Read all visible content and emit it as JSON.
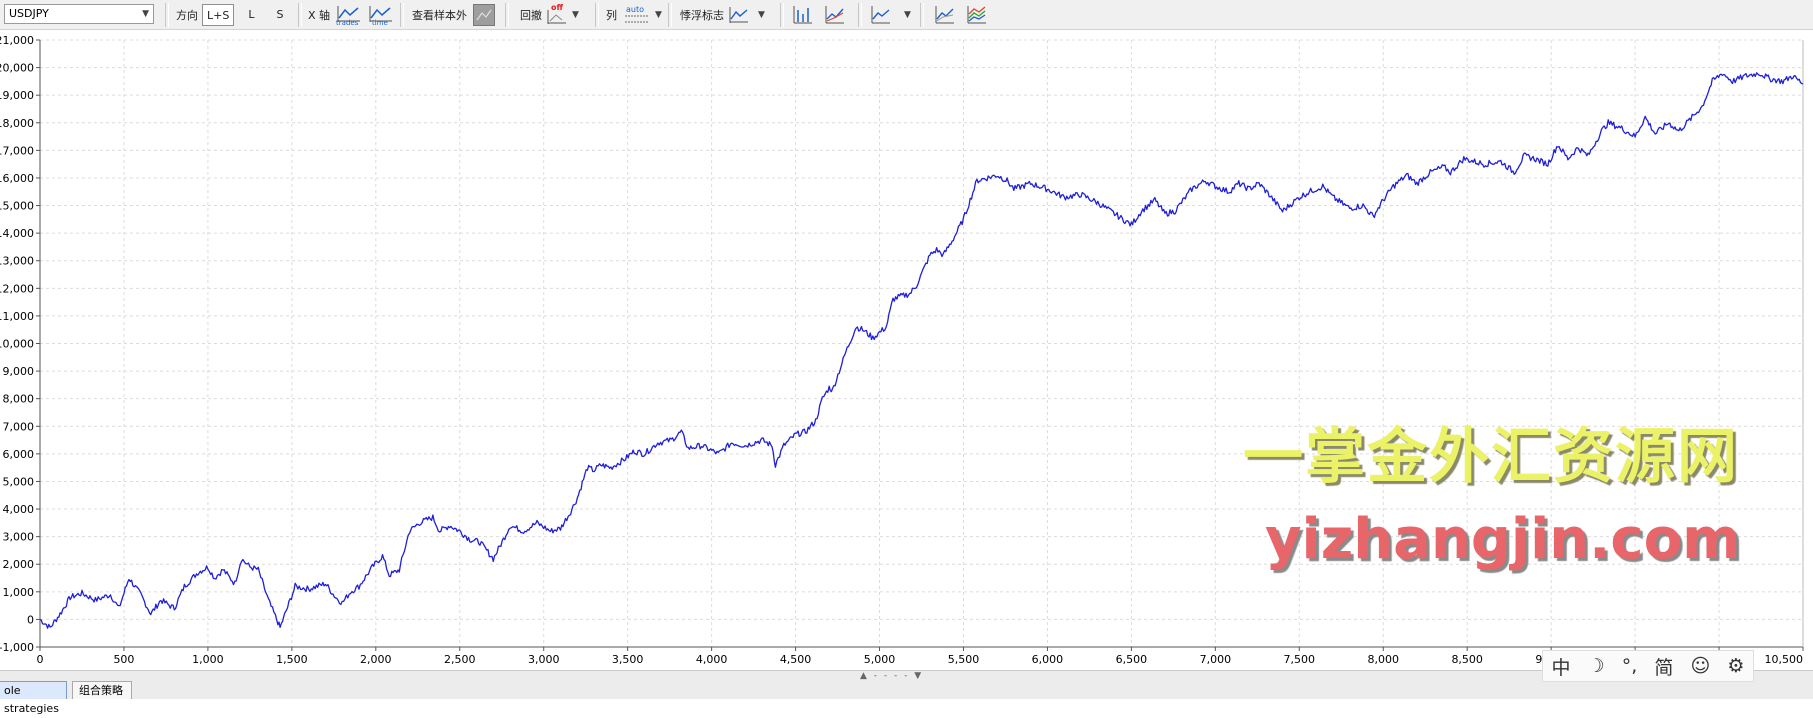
{
  "toolbar": {
    "symbol": "USDJPY",
    "direction_label": "方向",
    "direction_options": [
      "L+S",
      "L",
      "S"
    ],
    "xaxis_label": "X 轴",
    "xaxis_trades": "trades",
    "xaxis_time": "time",
    "out_of_sample_label": "查看样本外",
    "drawdown_label": "回撤",
    "drawdown_state": "off",
    "column_label": "列",
    "column_state": "auto",
    "floating_label": "悸浮标志"
  },
  "chart_data": {
    "type": "line",
    "title": "",
    "xlabel": "",
    "ylabel": "",
    "xlim": [
      0,
      10500
    ],
    "ylim": [
      -1000,
      21000
    ],
    "x_ticks": [
      "0",
      "500",
      "1,000",
      "1,500",
      "2,000",
      "2,500",
      "3,000",
      "3,500",
      "4,000",
      "4,500",
      "5,000",
      "5,500",
      "6,000",
      "6,500",
      "7,000",
      "7,500",
      "8,000",
      "8,500",
      "9,000",
      "9,500",
      "10,000",
      "10,500"
    ],
    "y_ticks": [
      "-1,000",
      "0",
      "1,000",
      "2,000",
      "3,000",
      "4,000",
      "5,000",
      "6,000",
      "7,000",
      "8,000",
      "9,000",
      "10,000",
      "11,000",
      "12,000",
      "13,000",
      "14,000",
      "15,000",
      "16,000",
      "17,000",
      "18,000",
      "19,000",
      "20,000",
      "21,000"
    ],
    "grid": true,
    "series": [
      {
        "color": "#1f1fd6",
        "x": [
          0,
          60,
          120,
          180,
          250,
          330,
          420,
          470,
          530,
          600,
          660,
          720,
          800,
          860,
          940,
          1000,
          1040,
          1090,
          1160,
          1200,
          1250,
          1300,
          1360,
          1410,
          1430,
          1460,
          1520,
          1600,
          1700,
          1760,
          1800,
          1850,
          1900,
          1980,
          2040,
          2080,
          2140,
          2200,
          2260,
          2340,
          2380,
          2440,
          2500,
          2560,
          2620,
          2700,
          2760,
          2800,
          2880,
          2960,
          3040,
          3100,
          3160,
          3200,
          3260,
          3300,
          3340,
          3400,
          3480,
          3540,
          3600,
          3680,
          3760,
          3820,
          3860,
          3940,
          4040,
          4120,
          4200,
          4300,
          4360,
          4380,
          4430,
          4500,
          4560,
          4620,
          4660,
          4700,
          4720,
          4760,
          4800,
          4860,
          4900,
          4960,
          5040,
          5080,
          5120,
          5180,
          5220,
          5300,
          5340,
          5380,
          5440,
          5500,
          5540,
          5580,
          5640,
          5700,
          5760,
          5800,
          5900,
          6000,
          6100,
          6200,
          6300,
          6400,
          6500,
          6560,
          6640,
          6700,
          6760,
          6860,
          6940,
          7000,
          7080,
          7140,
          7200,
          7260,
          7320,
          7400,
          7500,
          7560,
          7640,
          7700,
          7800,
          7880,
          7940,
          8000,
          8060,
          8140,
          8200,
          8280,
          8360,
          8400,
          8480,
          8600,
          8700,
          8780,
          8840,
          8900,
          8980,
          9040,
          9100,
          9160,
          9220,
          9300,
          9340,
          9420,
          9500,
          9560,
          9620,
          9700,
          9760,
          9840,
          9900,
          9960,
          10020,
          10080,
          10160,
          10240,
          10300,
          10380,
          10440,
          10500
        ],
        "y": [
          0,
          -300,
          200,
          800,
          950,
          700,
          900,
          400,
          1500,
          900,
          200,
          700,
          400,
          1200,
          1700,
          1900,
          1500,
          1800,
          1300,
          2200,
          1900,
          1800,
          700,
          0,
          -300,
          200,
          1200,
          1100,
          1300,
          800,
          600,
          1000,
          1200,
          1900,
          2300,
          1600,
          1800,
          3200,
          3500,
          3700,
          3200,
          3400,
          3200,
          2900,
          2800,
          2200,
          2900,
          3400,
          3200,
          3500,
          3200,
          3300,
          3900,
          4400,
          5500,
          5400,
          5600,
          5500,
          5800,
          6100,
          6000,
          6400,
          6500,
          6800,
          6200,
          6300,
          6000,
          6400,
          6300,
          6500,
          6300,
          5600,
          6300,
          6700,
          6800,
          7200,
          8000,
          8400,
          8300,
          9000,
          9700,
          10600,
          10500,
          10200,
          10600,
          11600,
          11700,
          11800,
          12100,
          13200,
          13400,
          13200,
          13800,
          14500,
          15200,
          15900,
          16000,
          16100,
          15900,
          15600,
          15800,
          15600,
          15300,
          15400,
          15100,
          14700,
          14300,
          14800,
          15200,
          14700,
          14800,
          15600,
          15900,
          15700,
          15500,
          15800,
          15600,
          15800,
          15400,
          14800,
          15300,
          15500,
          15700,
          15300,
          14900,
          15000,
          14600,
          15200,
          15700,
          16100,
          15800,
          16200,
          16400,
          16200,
          16700,
          16500,
          16600,
          16200,
          16800,
          16700,
          16500,
          17200,
          16700,
          17100,
          16800,
          17700,
          18000,
          17800,
          17500,
          18200,
          17600,
          18000,
          17700,
          18200,
          18600,
          19500,
          19800,
          19500,
          19700,
          19800,
          19600,
          19500,
          19700,
          19400
        ]
      }
    ]
  },
  "watermark": {
    "line1": "一掌金外汇资源网",
    "line2": "yizhangjin.com"
  },
  "bottom_tabs": [
    "ole strategies",
    "组合策略"
  ],
  "ime": [
    "中",
    "☽",
    "°,",
    "简",
    "☺",
    "⚙"
  ]
}
